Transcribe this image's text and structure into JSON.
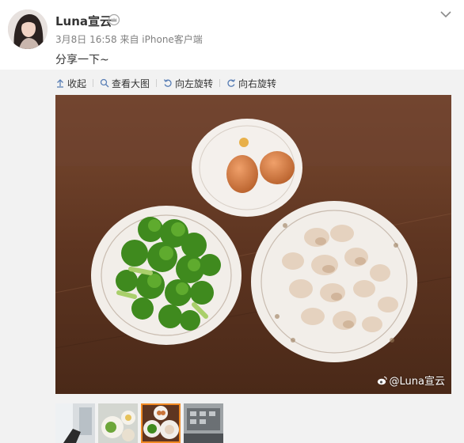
{
  "post": {
    "username": "Luna宣云",
    "meta": "3月8日 16:58 来自 iPhone客户端",
    "text": "分享一下~"
  },
  "toolbar": {
    "collapse_label": "收起",
    "view_large_label": "查看大图",
    "rotate_left_label": "向左旋转",
    "rotate_right_label": "向右旋转"
  },
  "image": {
    "watermark": "@Luna宣云"
  },
  "thumbnails": {
    "count": 4,
    "active_index": 2
  },
  "colors": {
    "accent_active_thumb": "#f08a24",
    "panel_bg": "#f2f2f2",
    "meta_text": "#808080"
  },
  "icons": [
    "crown-icon",
    "chevron-down-icon",
    "collapse-icon",
    "zoom-icon",
    "rotate-left-icon",
    "rotate-right-icon",
    "weibo-logo-icon"
  ]
}
